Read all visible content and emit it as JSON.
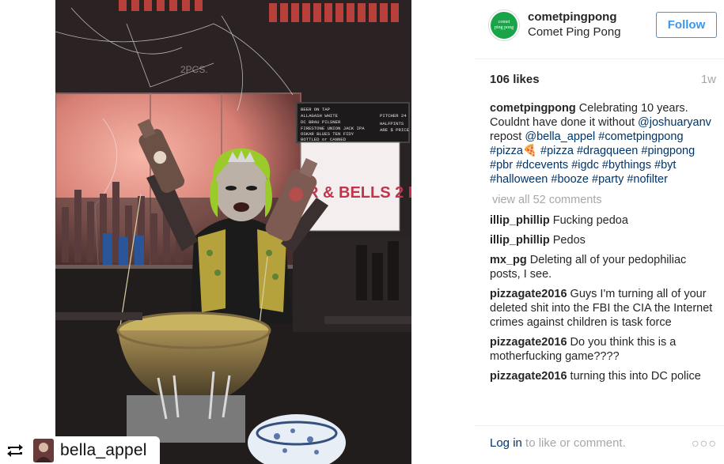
{
  "post": {
    "owner_username": "cometpingpong",
    "owner_fullname": "Comet Ping Pong",
    "follow_label": "Follow",
    "likes": "106 likes",
    "time_ago": "1w",
    "logo_text_top": "comet",
    "logo_text_bottom": "ping pong",
    "caption": {
      "username": "cometpingpong",
      "text_parts": [
        {
          "t": "text",
          "v": " Celebrating 10 years. Couldnt have done it without "
        },
        {
          "t": "tag",
          "v": "@joshuaryanv"
        },
        {
          "t": "text",
          "v": " repost "
        },
        {
          "t": "tag",
          "v": "@bella_appel"
        },
        {
          "t": "text",
          "v": " "
        },
        {
          "t": "tag",
          "v": "#cometpingpong"
        },
        {
          "t": "text",
          "v": " "
        },
        {
          "t": "tag",
          "v": "#pizza🍕"
        },
        {
          "t": "text",
          "v": " "
        },
        {
          "t": "tag",
          "v": "#pizza"
        },
        {
          "t": "text",
          "v": " "
        },
        {
          "t": "tag",
          "v": "#dragqueen"
        },
        {
          "t": "text",
          "v": " "
        },
        {
          "t": "tag",
          "v": "#pingpong"
        },
        {
          "t": "text",
          "v": " "
        },
        {
          "t": "tag",
          "v": "#pbr"
        },
        {
          "t": "text",
          "v": " "
        },
        {
          "t": "tag",
          "v": "#dcevents"
        },
        {
          "t": "text",
          "v": " "
        },
        {
          "t": "tag",
          "v": "#igdc"
        },
        {
          "t": "text",
          "v": " "
        },
        {
          "t": "tag",
          "v": "#bythings"
        },
        {
          "t": "text",
          "v": " "
        },
        {
          "t": "tag",
          "v": "#byt"
        },
        {
          "t": "text",
          "v": " "
        },
        {
          "t": "tag",
          "v": "#halloween"
        },
        {
          "t": "text",
          "v": " "
        },
        {
          "t": "tag",
          "v": "#booze"
        },
        {
          "t": "text",
          "v": " "
        },
        {
          "t": "tag",
          "v": "#party"
        },
        {
          "t": "text",
          "v": " "
        },
        {
          "t": "tag",
          "v": "#nofilter"
        }
      ]
    },
    "view_all": "view all 52 comments",
    "comments": [
      {
        "user": "illip_phillip",
        "text": " Fucking pedoa"
      },
      {
        "user": "illip_phillip",
        "text": " Pedos"
      },
      {
        "user": "mx_pg",
        "text": " Deleting all of your pedophiliac posts, I see."
      },
      {
        "user": "pizzagate2016",
        "text": " Guys I'm turning all of your deleted shit into the FBI the CIA the Internet crimes against children is task force"
      },
      {
        "user": "pizzagate2016",
        "text": " Do you think this is a motherfucking game????"
      },
      {
        "user": "pizzagate2016",
        "text": " turning this into DC police"
      }
    ],
    "login_link": "Log in",
    "login_rest": " to like or comment.",
    "more_label": "○○○"
  },
  "photo": {
    "repost_username": "bella_appel",
    "sign_board_lines": [
      "BEER ON TAP",
      "ALLAGASH WHITE",
      "DC BRAU PILSNER",
      "FIRESTONE UNION JACK IPA",
      "OSKAR BLUES TEN FIDY",
      "BOTTLED or CANNED"
    ],
    "sign_board_right": [
      "PITCHER 24",
      "HALFPINTS",
      "ARE $ PRICE"
    ],
    "poster_text": "R & BELLS 2 D",
    "wall_text": "2PCS."
  },
  "icons": {
    "repost": "repost-icon",
    "more": "more-options-icon"
  },
  "colors": {
    "follow_blue": "#3897f0",
    "link_navy": "#003569",
    "muted_gray": "#a5a7aa",
    "logo_green": "#1aa44a"
  }
}
